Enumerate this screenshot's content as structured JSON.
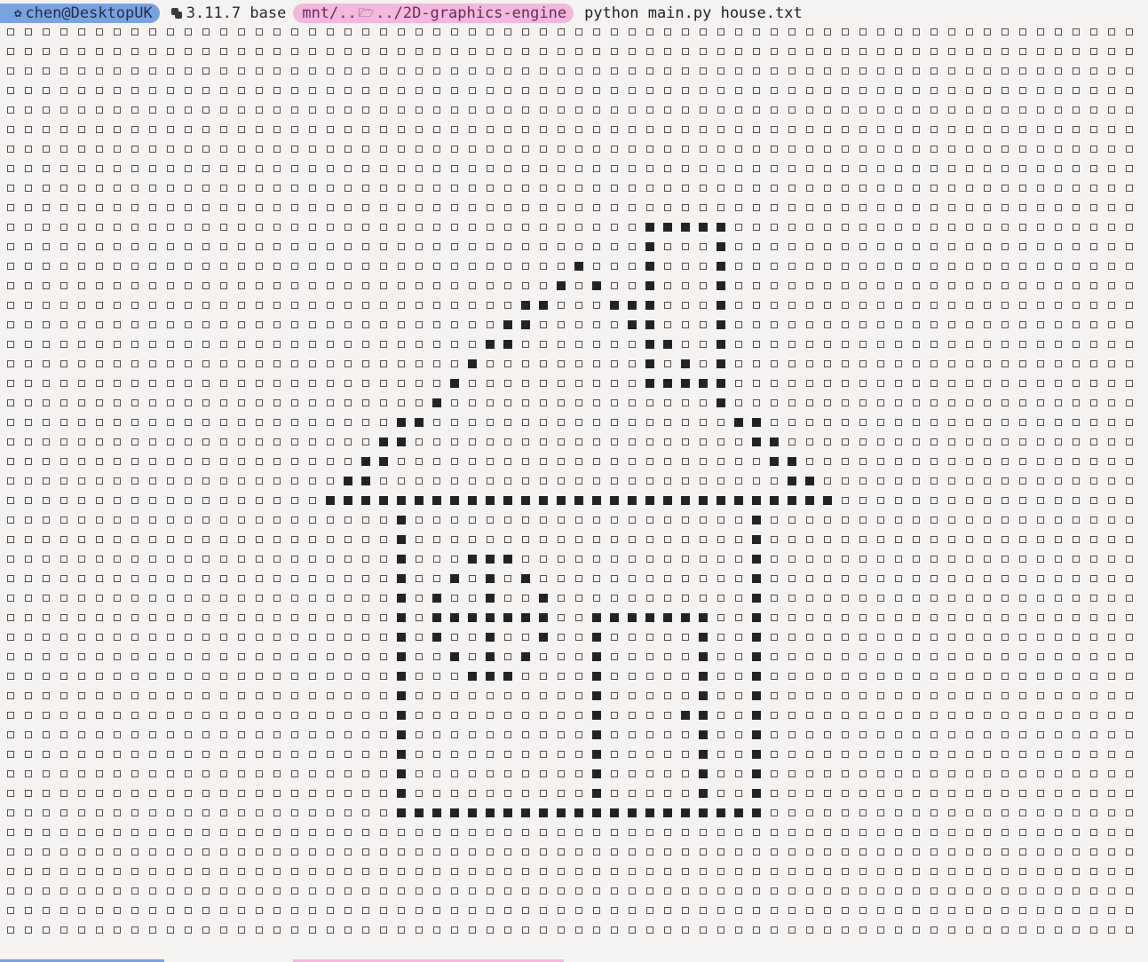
{
  "prompt": {
    "user_host": "chen@DesktopUK",
    "user_icon": "distro-logo-icon",
    "python_icon": "python-icon",
    "python_env": "3.11.7 base",
    "path_prefix": "mnt/..",
    "folder_icon": "folder-icon",
    "path_suffix": "../2D-graphics-engine",
    "command": "python main.py house.txt"
  },
  "grid": {
    "cols": 64,
    "rows": 47,
    "on_cells": {
      "10": [
        36,
        37,
        38,
        39,
        40
      ],
      "11": [
        36,
        40
      ],
      "12": [
        32,
        36,
        40
      ],
      "13": [
        31,
        33,
        36,
        40
      ],
      "14": [
        29,
        30,
        34,
        35,
        36,
        40
      ],
      "15": [
        28,
        29,
        35,
        36,
        40
      ],
      "16": [
        27,
        28,
        36,
        37,
        40
      ],
      "17": [
        26,
        36,
        38,
        40
      ],
      "18": [
        25,
        36,
        37,
        38,
        39,
        40
      ],
      "19": [
        24,
        40
      ],
      "20": [
        22,
        23,
        41,
        42
      ],
      "21": [
        21,
        22,
        42,
        43
      ],
      "22": [
        20,
        21,
        43,
        44
      ],
      "23": [
        19,
        20,
        44,
        45
      ],
      "24": [
        18,
        19,
        20,
        21,
        22,
        23,
        24,
        25,
        26,
        27,
        28,
        29,
        30,
        31,
        32,
        33,
        34,
        35,
        36,
        37,
        38,
        39,
        40,
        41,
        42,
        43,
        44,
        45,
        46
      ],
      "25": [
        22,
        42
      ],
      "26": [
        22,
        42
      ],
      "27": [
        22,
        26,
        27,
        28,
        42
      ],
      "28": [
        22,
        25,
        27,
        29,
        42
      ],
      "29": [
        22,
        24,
        27,
        30,
        42
      ],
      "30": [
        22,
        24,
        25,
        26,
        27,
        28,
        29,
        30,
        33,
        34,
        35,
        36,
        37,
        38,
        39,
        42
      ],
      "31": [
        22,
        24,
        27,
        30,
        33,
        39,
        42
      ],
      "32": [
        22,
        25,
        27,
        29,
        33,
        39,
        42
      ],
      "33": [
        22,
        26,
        27,
        28,
        33,
        39,
        42
      ],
      "34": [
        22,
        33,
        39,
        42
      ],
      "35": [
        22,
        33,
        38,
        39,
        42
      ],
      "36": [
        22,
        33,
        39,
        42
      ],
      "37": [
        22,
        33,
        39,
        42
      ],
      "38": [
        22,
        33,
        39,
        42
      ],
      "39": [
        22,
        33,
        39,
        42
      ],
      "40": [
        22,
        23,
        24,
        25,
        26,
        27,
        28,
        29,
        30,
        31,
        32,
        33,
        34,
        35,
        36,
        37,
        38,
        39,
        40,
        41,
        42
      ]
    }
  }
}
